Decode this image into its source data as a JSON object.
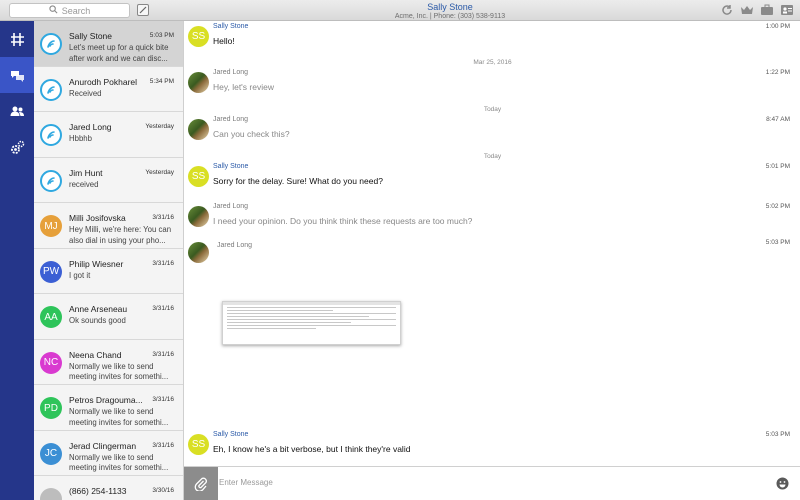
{
  "search": {
    "placeholder": "Search"
  },
  "header": {
    "contact_name": "Sally Stone",
    "contact_sub": "Acme, Inc. | Phone: (303) 538-9113"
  },
  "nav": {
    "items": [
      {
        "icon": "hashtag-icon"
      },
      {
        "icon": "chat-bubbles-icon",
        "active": true
      },
      {
        "icon": "contacts-icon"
      },
      {
        "icon": "settings-gears-icon"
      }
    ]
  },
  "conversations": [
    {
      "name": "Sally Stone",
      "time": "5:03 PM",
      "preview": "Let's meet up for a quick bite after work and we can disc...",
      "avatar": "logo",
      "selected": true
    },
    {
      "name": "Anurodh Pokharel",
      "time": "5:34 PM",
      "preview": "Received",
      "avatar": "logo"
    },
    {
      "name": "Jared Long",
      "time": "Yesterday",
      "preview": "Hbbhb",
      "avatar": "logo"
    },
    {
      "name": "Jim Hunt",
      "time": "Yesterday",
      "preview": "received",
      "avatar": "logo"
    },
    {
      "name": "Milli Josifovska",
      "time": "3/31/16",
      "preview": "Hey Milli, we're here: You can also dial in using your pho...",
      "initials": "MJ",
      "color": "#e6a03a"
    },
    {
      "name": "Philip Wiesner",
      "time": "3/31/16",
      "preview": "I got it",
      "initials": "PW",
      "color": "#3b5fd4"
    },
    {
      "name": "Anne Arseneau",
      "time": "3/31/16",
      "preview": "Ok sounds good",
      "initials": "AA",
      "color": "#2ec45a"
    },
    {
      "name": "Neena Chand",
      "time": "3/31/16",
      "preview": "Normally we like to send meeting invites for somethi...",
      "initials": "NC",
      "color": "#d93ad0"
    },
    {
      "name": "Petros Dragouma...",
      "time": "3/31/16",
      "preview": "Normally we like to send meeting invites for somethi...",
      "initials": "PD",
      "color": "#2ec45a"
    },
    {
      "name": "Jerad Clingerman",
      "time": "3/31/16",
      "preview": "Normally we like to send meeting invites for somethi...",
      "initials": "JC",
      "color": "#3b8fd4"
    },
    {
      "name": "(866) 254-1133",
      "time": "3/30/16",
      "preview": "",
      "initials": "",
      "color": "#bdbdbd"
    }
  ],
  "messages": [
    {
      "type": "msg",
      "sender": "Sally Stone",
      "avatar": "SS",
      "time": "1:00 PM",
      "text": "Hello!"
    },
    {
      "type": "date",
      "text": "Mar 25, 2016"
    },
    {
      "type": "msg",
      "sender": "Jared Long",
      "avatar": "photo",
      "time": "1:22 PM",
      "text": "Hey, let's review"
    },
    {
      "type": "date",
      "text": "Today"
    },
    {
      "type": "msg",
      "sender": "Jared Long",
      "avatar": "photo",
      "time": "8:47 AM",
      "text": "Can you check this?"
    },
    {
      "type": "date",
      "text": "Today"
    },
    {
      "type": "msg",
      "sender": "Sally Stone",
      "avatar": "SS",
      "time": "5:01 PM",
      "text": "Sorry for the delay. Sure! What do you need?"
    },
    {
      "type": "msg",
      "sender": "Jared Long",
      "avatar": "photo",
      "time": "5:02 PM",
      "text": "I need your opinion. Do you think think these requests are too much?"
    },
    {
      "type": "msg",
      "sender": "Jared Long",
      "avatar": "photo",
      "time": "5:03 PM",
      "text": ""
    },
    {
      "type": "msg",
      "sender": "Sally Stone",
      "avatar": "SS",
      "time": "5:03 PM",
      "text": "Eh, I know he's a bit verbose, but I think they're valid"
    }
  ],
  "composer": {
    "placeholder": "Enter Message"
  },
  "colors": {
    "rail": "#25368a",
    "rail_active": "#3a55c7",
    "sally_avatar": "#d9df24",
    "link": "#2b5aa8"
  }
}
